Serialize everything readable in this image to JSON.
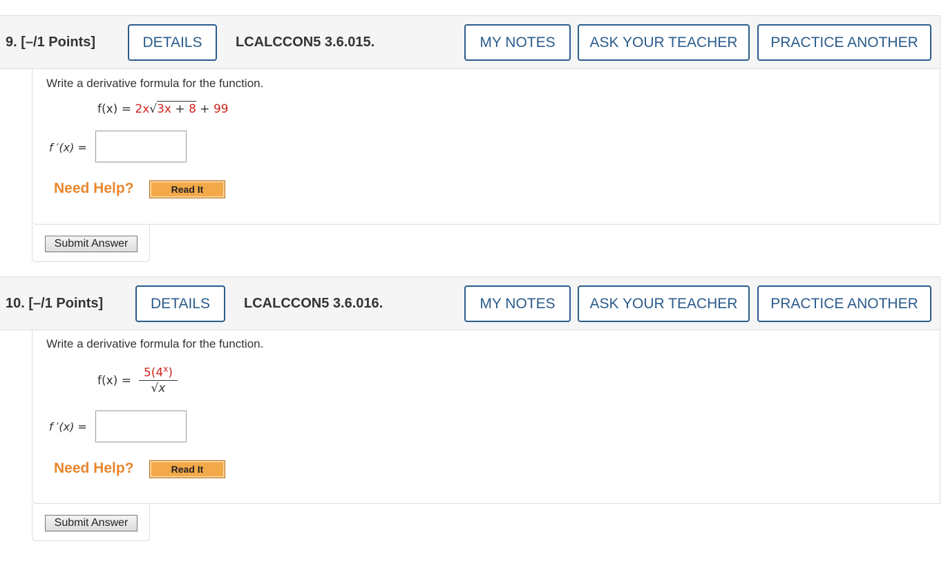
{
  "q9": {
    "number": "9.",
    "points": "[–/1 Points]",
    "details": "DETAILS",
    "code": "LCALCCON5 3.6.015.",
    "my_notes": "MY NOTES",
    "ask_teacher": "ASK YOUR TEACHER",
    "practice": "PRACTICE ANOTHER",
    "instruction": "Write a derivative formula for the function.",
    "fx_lhs": "f(x) =",
    "fx_coef": "2x",
    "fx_radicand_a": "3x",
    "fx_plus1": "+",
    "fx_radicand_b": "8",
    "fx_plus2": "+",
    "fx_const": "99",
    "answer_label": "f ′(x) =",
    "answer_value": "",
    "need_help": "Need Help?",
    "read_it": "Read It",
    "submit": "Submit Answer"
  },
  "q10": {
    "number": "10.",
    "points": "[–/1 Points]",
    "details": "DETAILS",
    "code": "LCALCCON5 3.6.016.",
    "my_notes": "MY NOTES",
    "ask_teacher": "ASK YOUR TEACHER",
    "practice": "PRACTICE ANOTHER",
    "instruction": "Write a derivative formula for the function.",
    "fx_lhs": "f(x) =",
    "num_coef": "5(4",
    "num_exp": "x",
    "num_close": ")",
    "den_var": "x",
    "answer_label": "f ′(x) =",
    "answer_value": "",
    "need_help": "Need Help?",
    "read_it": "Read It",
    "submit": "Submit Answer"
  },
  "colors": {
    "accent": "#2a5b8b",
    "help": "#e8862d",
    "highlight": "#d0251d",
    "header_bg": "#f5f5f5"
  }
}
